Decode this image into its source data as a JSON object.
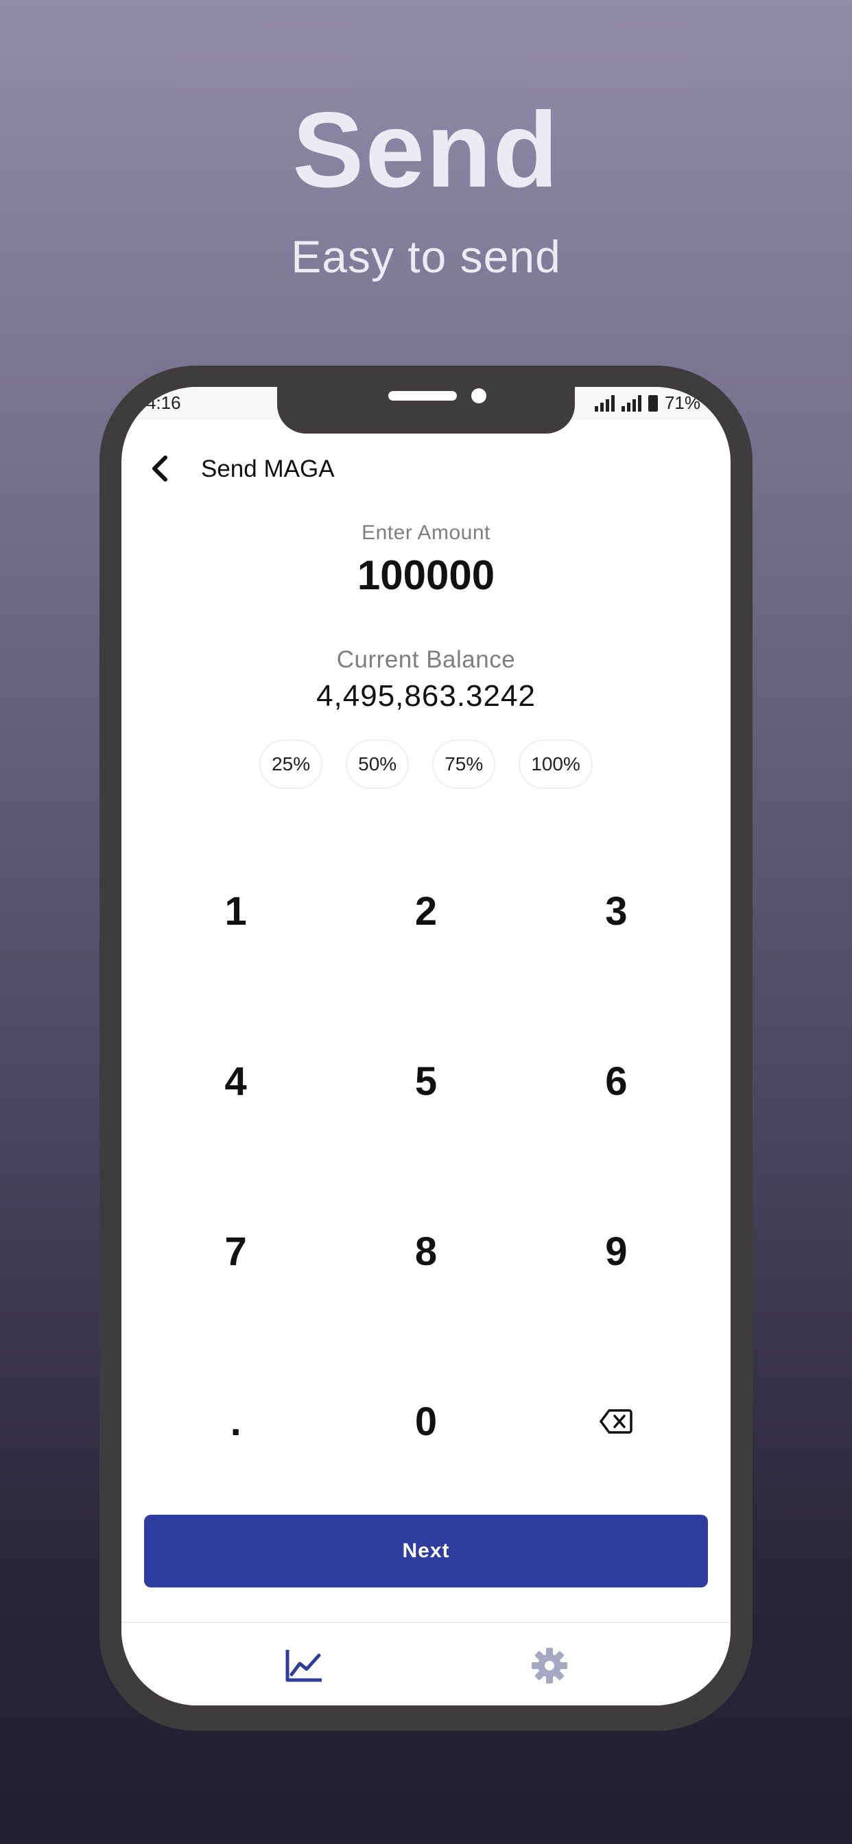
{
  "promo": {
    "headline": "Send",
    "subheadline": "Easy to send"
  },
  "status_bar": {
    "time": "4:16",
    "battery": "71%"
  },
  "header": {
    "back_icon": "chevron-left-icon",
    "title": "Send MAGA"
  },
  "amount": {
    "label": "Enter Amount",
    "value": "100000"
  },
  "balance": {
    "label": "Current Balance",
    "value": "4,495,863.3242"
  },
  "percent_buttons": [
    "25%",
    "50%",
    "75%",
    "100%"
  ],
  "keypad": {
    "keys": [
      "1",
      "2",
      "3",
      "4",
      "5",
      "6",
      "7",
      "8",
      "9",
      ".",
      "0"
    ],
    "backspace_icon": "backspace-icon"
  },
  "next_button": {
    "label": "Next"
  },
  "tabbar": {
    "tabs": [
      {
        "icon": "chart-icon",
        "active": true
      },
      {
        "icon": "gear-icon",
        "active": false
      }
    ]
  },
  "colors": {
    "primary": "#2f3e9e",
    "tab_inactive": "#a7a9c2",
    "frame": "#3f3c3d"
  }
}
